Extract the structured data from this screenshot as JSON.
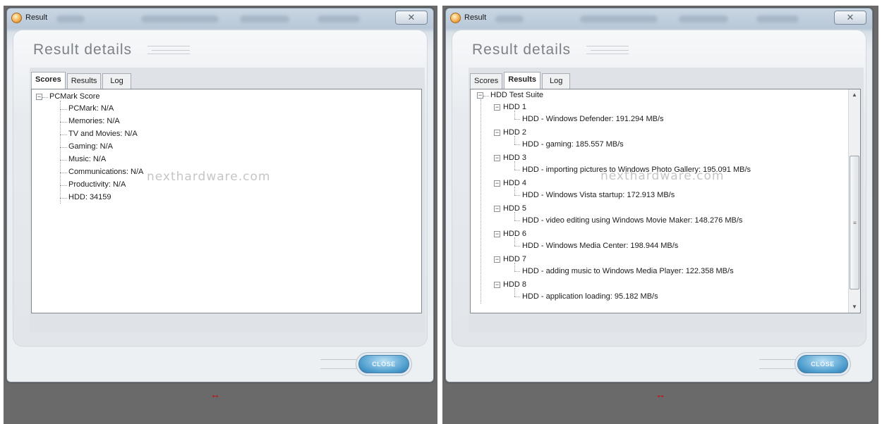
{
  "left": {
    "window_title": "Result",
    "close_glyph": "✕",
    "heading": "Result details",
    "tabs": [
      {
        "label": "Scores",
        "active": true
      },
      {
        "label": "Results",
        "active": false
      },
      {
        "label": "Log",
        "active": false
      }
    ],
    "tree": {
      "root": "PCMark Score",
      "items": [
        "PCMark: N/A",
        "Memories: N/A",
        "TV and Movies: N/A",
        "Gaming: N/A",
        "Music: N/A",
        "Communications: N/A",
        "Productivity: N/A",
        "HDD: 34159"
      ]
    },
    "watermark": "nexthardware.com",
    "close_button": "CLOSE",
    "resize_icon": "↔"
  },
  "right": {
    "window_title": "Result",
    "close_glyph": "✕",
    "heading": "Result details",
    "tabs": [
      {
        "label": "Scores",
        "active": false
      },
      {
        "label": "Results",
        "active": true
      },
      {
        "label": "Log",
        "active": false
      }
    ],
    "tree": {
      "root": "HDD Test Suite",
      "groups": [
        {
          "label": "HDD 1",
          "result": "HDD - Windows Defender: 191.294 MB/s"
        },
        {
          "label": "HDD 2",
          "result": "HDD - gaming: 185.557 MB/s"
        },
        {
          "label": "HDD 3",
          "result": "HDD - importing pictures to Windows Photo Gallery: 195.091 MB/s"
        },
        {
          "label": "HDD 4",
          "result": "HDD - Windows Vista startup: 172.913 MB/s"
        },
        {
          "label": "HDD 5",
          "result": "HDD - video editing using Windows Movie Maker: 148.276 MB/s"
        },
        {
          "label": "HDD 6",
          "result": "HDD - Windows Media Center: 198.944 MB/s"
        },
        {
          "label": "HDD 7",
          "result": "HDD - adding music to Windows Media Player: 122.358 MB/s"
        },
        {
          "label": "HDD 8",
          "result": "HDD - application loading: 95.182 MB/s"
        }
      ]
    },
    "watermark": "nexthardware.com",
    "close_button": "CLOSE",
    "resize_icon": "↔"
  }
}
